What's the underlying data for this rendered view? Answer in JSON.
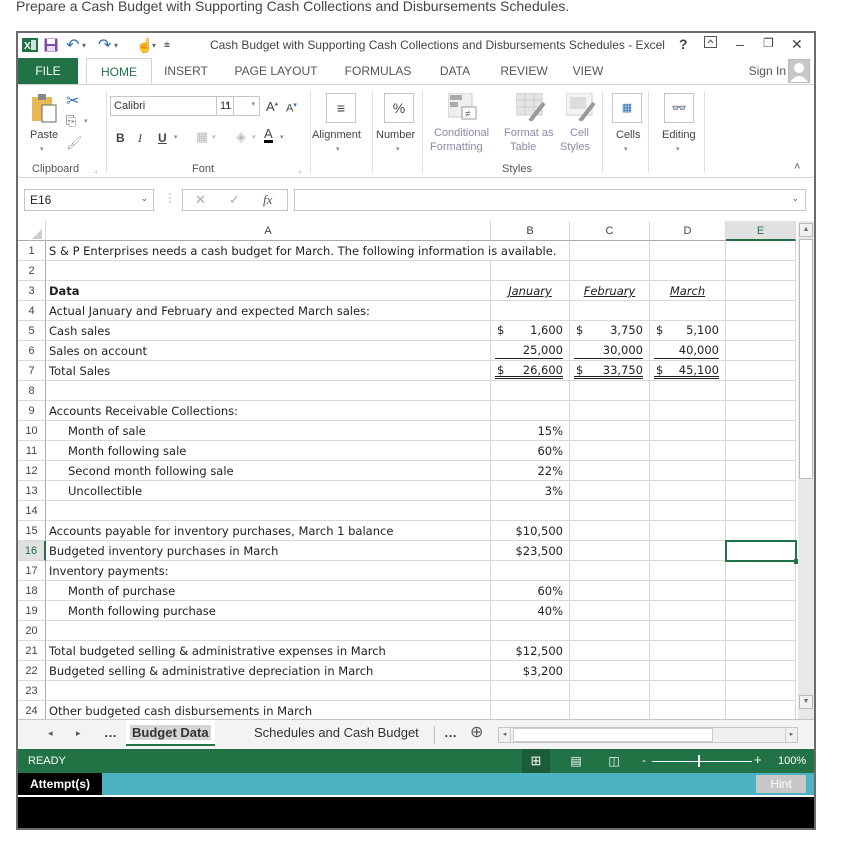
{
  "instructions": "Prepare a Cash Budget with Supporting Cash Collections and Disbursements Schedules.",
  "window": {
    "title": "Cash Budget with Supporting Cash Collections and Disbursements Schedules - Excel",
    "help": "?",
    "sign_in": "Sign In"
  },
  "ribbon_tabs": [
    "FILE",
    "HOME",
    "INSERT",
    "PAGE LAYOUT",
    "FORMULAS",
    "DATA",
    "REVIEW",
    "VIEW"
  ],
  "active_tab": "HOME",
  "ribbon": {
    "clipboard": {
      "paste": "Paste",
      "label": "Clipboard"
    },
    "font": {
      "name": "Calibri",
      "size": "11",
      "bold": "B",
      "italic": "I",
      "underline": "U",
      "label": "Font"
    },
    "alignment": {
      "label": "Alignment",
      "icon": "≡"
    },
    "number": {
      "label": "Number",
      "icon": "%"
    },
    "styles": {
      "conditional": "Conditional",
      "conditional2": "Formatting",
      "format_as": "Format as",
      "table": "Table",
      "cell": "Cell",
      "cell_styles": "Styles",
      "label": "Styles"
    },
    "cells": {
      "label": "Cells"
    },
    "editing": {
      "label": "Editing"
    }
  },
  "formula_bar": {
    "name_box": "E16",
    "fx": "fx",
    "value": ""
  },
  "columns": [
    "A",
    "B",
    "C",
    "D",
    "E"
  ],
  "selected_cell": "E16",
  "rows": [
    {
      "n": "1",
      "a": "S & P Enterprises needs a cash budget for March. The following information is available."
    },
    {
      "n": "2",
      "a": ""
    },
    {
      "n": "3",
      "a": "Data",
      "b": "January",
      "c": "February",
      "d": "March"
    },
    {
      "n": "4",
      "a": "Actual January and February and expected March sales:"
    },
    {
      "n": "5",
      "a": "Cash sales",
      "b": "1,600",
      "c": "3,750",
      "d": "5,100"
    },
    {
      "n": "6",
      "a": "Sales on account",
      "b": "25,000",
      "c": "30,000",
      "d": "40,000"
    },
    {
      "n": "7",
      "a": "Total Sales",
      "b": "26,600",
      "c": "33,750",
      "d": "45,100"
    },
    {
      "n": "8",
      "a": ""
    },
    {
      "n": "9",
      "a": "Accounts Receivable Collections:"
    },
    {
      "n": "10",
      "a": "Month of sale",
      "b": "15%"
    },
    {
      "n": "11",
      "a": "Month following sale",
      "b": "60%"
    },
    {
      "n": "12",
      "a": "Second month following sale",
      "b": "22%"
    },
    {
      "n": "13",
      "a": "Uncollectible",
      "b": "3%"
    },
    {
      "n": "14",
      "a": ""
    },
    {
      "n": "15",
      "a": "Accounts payable for inventory purchases, March 1 balance",
      "b": "$10,500"
    },
    {
      "n": "16",
      "a": "Budgeted inventory purchases in March",
      "b": "$23,500"
    },
    {
      "n": "17",
      "a": "Inventory payments:"
    },
    {
      "n": "18",
      "a": "Month of purchase",
      "b": "60%"
    },
    {
      "n": "19",
      "a": "Month following purchase",
      "b": "40%"
    },
    {
      "n": "20",
      "a": ""
    },
    {
      "n": "21",
      "a": "Total budgeted selling & administrative expenses in March",
      "b": "$12,500"
    },
    {
      "n": "22",
      "a": "Budgeted selling & administrative depreciation in March",
      "b": "$3,200"
    },
    {
      "n": "23",
      "a": ""
    },
    {
      "n": "24",
      "a": "Other budgeted cash disbursements in March"
    }
  ],
  "currency_symbol": "$",
  "sheets": [
    "Budget Data",
    "Schedules and Cash Budget"
  ],
  "active_sheet": "Budget Data",
  "status": {
    "ready": "READY",
    "zoom": "100%"
  },
  "attempts": {
    "label": "Attempt(s)",
    "hint": "Hint"
  },
  "colors": {
    "excel_green": "#217346",
    "attempt_bar": "#4db2c4"
  }
}
